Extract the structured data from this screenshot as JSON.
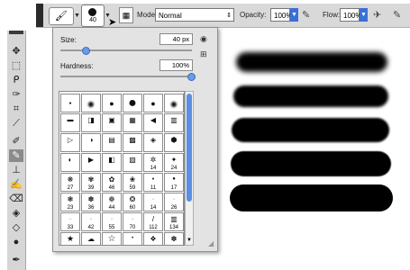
{
  "options_bar": {
    "brush_size_value": "40",
    "mode_label": "Mode:",
    "mode_value": "Normal",
    "opacity_label": "Opacity:",
    "opacity_value": "100%",
    "flow_label": "Flow:",
    "flow_value": "100%"
  },
  "brush_panel": {
    "size_label": "Size:",
    "size_value": "40 px",
    "size_level_fraction": 0.19,
    "hardness_label": "Hardness:",
    "hardness_value": "100%",
    "hardness_level_fraction": 1.0,
    "preset_numbers": [
      [
        "",
        "",
        "",
        "",
        "",
        ""
      ],
      [
        "",
        "",
        "",
        "",
        "",
        ""
      ],
      [
        "",
        "",
        "",
        "",
        "",
        ""
      ],
      [
        "",
        "",
        "",
        "",
        "14",
        "24"
      ],
      [
        "27",
        "39",
        "46",
        "59",
        "11",
        "17"
      ],
      [
        "23",
        "36",
        "44",
        "60",
        "14",
        "26"
      ],
      [
        "33",
        "42",
        "55",
        "70",
        "112",
        "134"
      ],
      [
        "74",
        "95",
        "29",
        "192",
        "36",
        "36"
      ]
    ]
  },
  "icons": {
    "tools": [
      "move-icon",
      "marquee-icon",
      "lasso-icon",
      "quick-select-icon",
      "crop-icon",
      "eyedropper-icon",
      "healing-brush-icon",
      "brush-icon",
      "clone-stamp-icon",
      "history-brush-icon",
      "eraser-icon",
      "gradient-icon",
      "blur-icon",
      "dodge-icon",
      "pen-icon"
    ]
  },
  "colors": {
    "accent": "#3a6fd6",
    "stroke": "#000000"
  }
}
